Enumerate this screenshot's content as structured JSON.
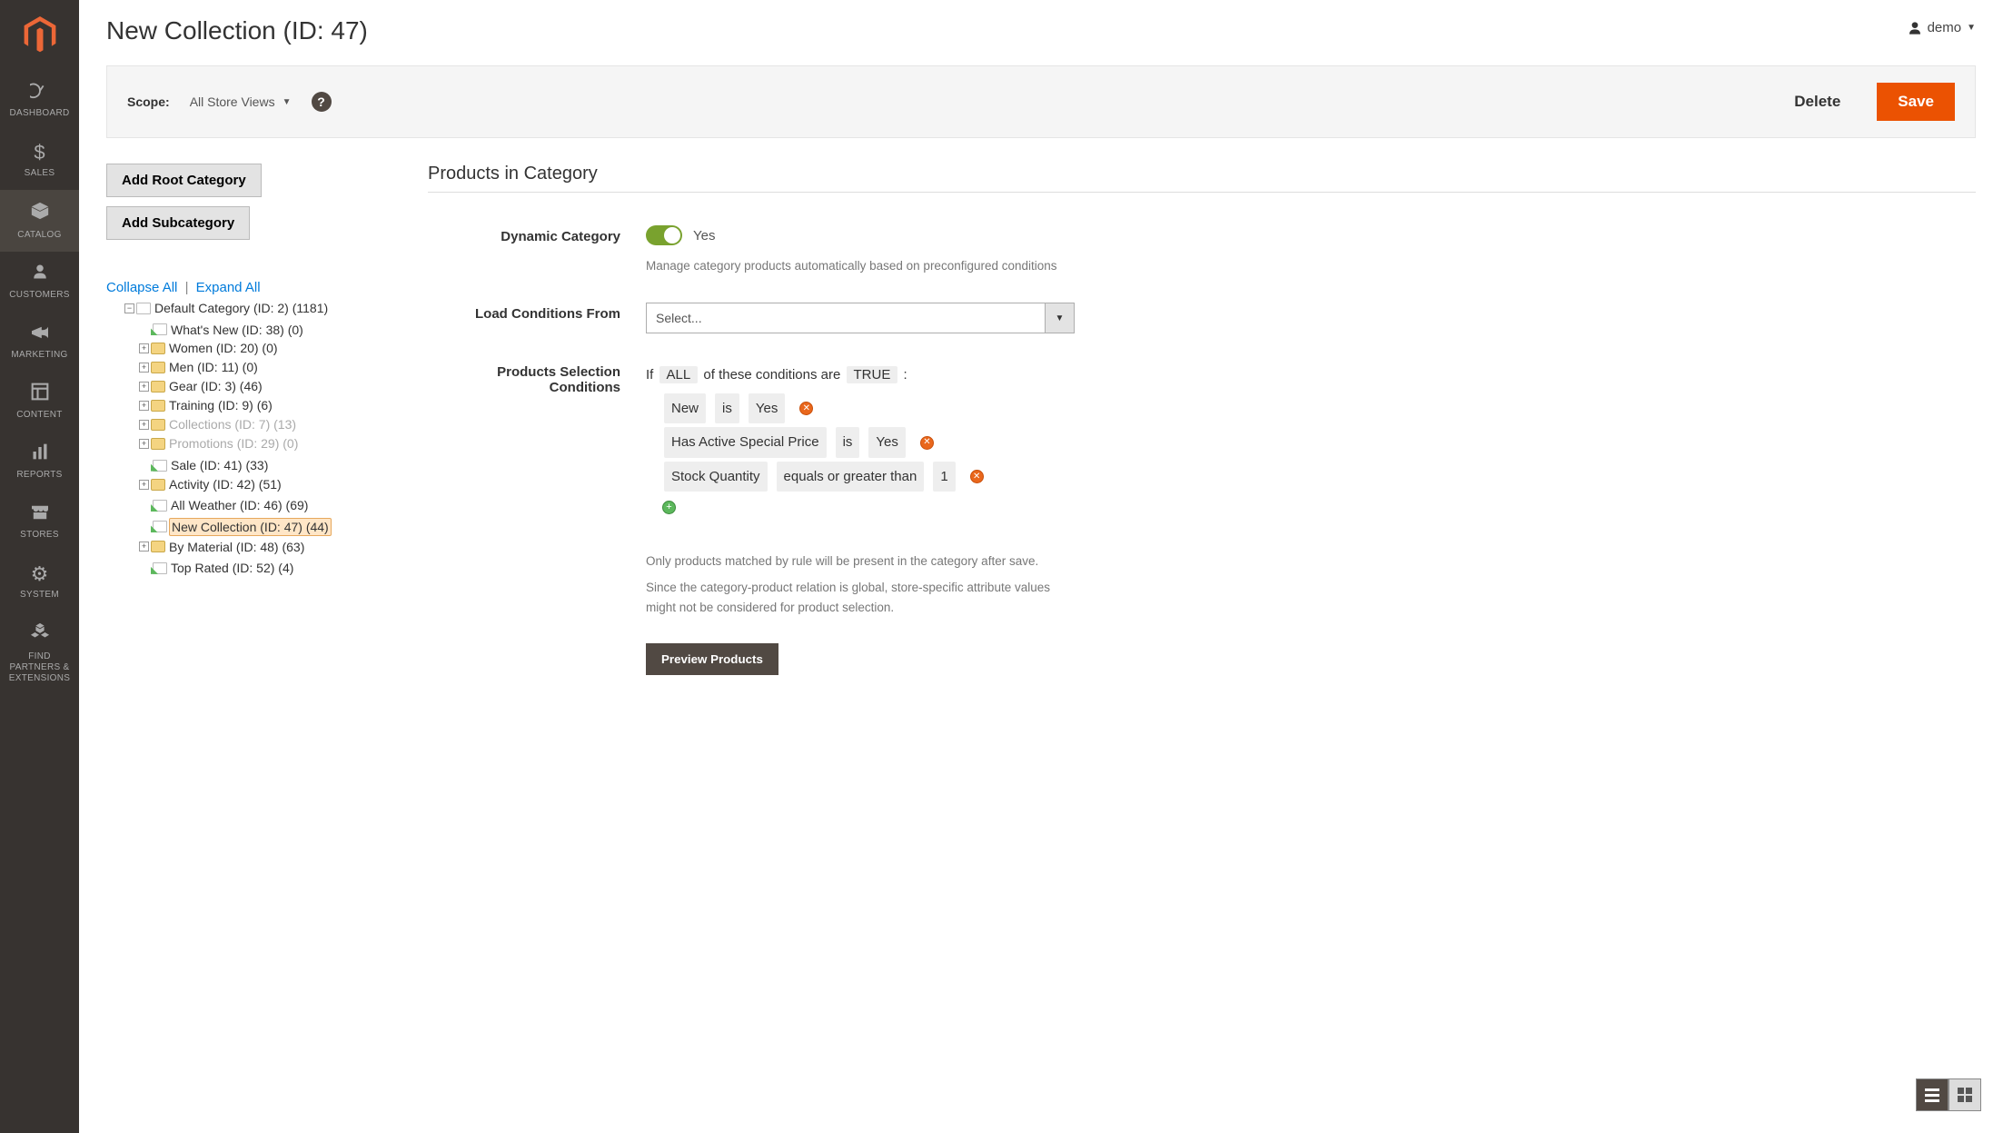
{
  "user": {
    "name": "demo"
  },
  "page": {
    "title": "New Collection (ID: 47)"
  },
  "nav": [
    {
      "label": "DASHBOARD"
    },
    {
      "label": "SALES"
    },
    {
      "label": "CATALOG"
    },
    {
      "label": "CUSTOMERS"
    },
    {
      "label": "MARKETING"
    },
    {
      "label": "CONTENT"
    },
    {
      "label": "REPORTS"
    },
    {
      "label": "STORES"
    },
    {
      "label": "SYSTEM"
    },
    {
      "label": "FIND PARTNERS & EXTENSIONS"
    }
  ],
  "toolbar": {
    "scope_label": "Scope:",
    "scope_value": "All Store Views",
    "delete": "Delete",
    "save": "Save"
  },
  "cat_actions": {
    "add_root": "Add Root Category",
    "add_sub": "Add Subcategory",
    "collapse": "Collapse All",
    "expand": "Expand All"
  },
  "tree": {
    "root": "Default Category (ID: 2) (1181)",
    "children": [
      {
        "text": "What's New (ID: 38) (0)",
        "icon": "page",
        "arrow": true
      },
      {
        "text": "Women (ID: 20) (0)",
        "icon": "folder",
        "toggle": "+"
      },
      {
        "text": "Men (ID: 11) (0)",
        "icon": "folder",
        "toggle": "+"
      },
      {
        "text": "Gear (ID: 3) (46)",
        "icon": "folder",
        "toggle": "+"
      },
      {
        "text": "Training (ID: 9) (6)",
        "icon": "folder",
        "toggle": "+"
      },
      {
        "text": "Collections (ID: 7) (13)",
        "icon": "folder",
        "toggle": "+",
        "dim": true
      },
      {
        "text": "Promotions (ID: 29) (0)",
        "icon": "folder",
        "toggle": "+",
        "dim": true
      },
      {
        "text": "Sale (ID: 41) (33)",
        "icon": "page",
        "arrow": true
      },
      {
        "text": "Activity (ID: 42) (51)",
        "icon": "folder",
        "toggle": "+"
      },
      {
        "text": "All Weather (ID: 46) (69)",
        "icon": "page",
        "arrow": true
      },
      {
        "text": "New Collection (ID: 47) (44)",
        "icon": "page",
        "arrow": true,
        "selected": true
      },
      {
        "text": "By Material (ID: 48) (63)",
        "icon": "folder",
        "toggle": "+"
      },
      {
        "text": "Top Rated (ID: 52) (4)",
        "icon": "page",
        "arrow": true
      }
    ]
  },
  "section": {
    "title": "Products in Category",
    "dynamic_label": "Dynamic Category",
    "dynamic_value": "Yes",
    "dynamic_note": "Manage category products automatically based on preconfigured conditions",
    "load_label": "Load Conditions From",
    "load_placeholder": "Select...",
    "conditions_label": "Products Selection Conditions",
    "cond_prefix": "If",
    "cond_aggregator": "ALL",
    "cond_middle": "of these conditions are",
    "cond_value": "TRUE",
    "cond_suffix": ":",
    "rules": [
      {
        "attr": "New",
        "op": "is",
        "val": "Yes"
      },
      {
        "attr": "Has Active Special Price",
        "op": "is",
        "val": "Yes"
      },
      {
        "attr": "Stock Quantity",
        "op": "equals or greater than",
        "val": "1"
      }
    ],
    "note1": "Only products matched by rule will be present in the category after save.",
    "note2": "Since the category-product relation is global, store-specific attribute values might not be considered for product selection.",
    "preview": "Preview Products"
  }
}
